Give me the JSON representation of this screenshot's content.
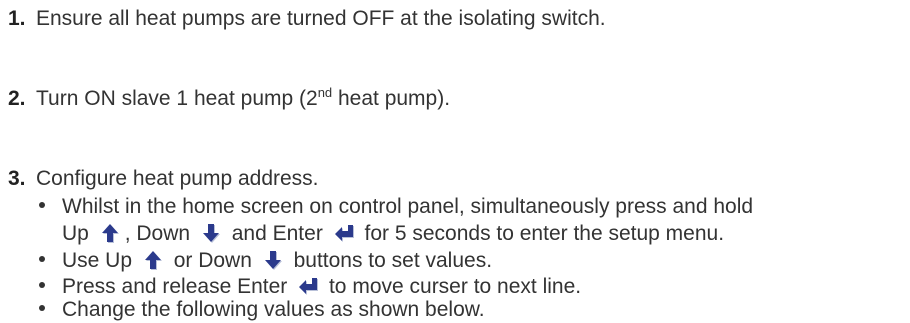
{
  "steps": [
    {
      "number": "1.",
      "text": "Ensure all heat pumps are turned OFF at the isolating switch."
    },
    {
      "number": "2.",
      "text_before": "Turn ON slave 1 heat pump (2",
      "sup": "nd",
      "text_after": " heat pump)."
    },
    {
      "number": "3.",
      "text": "Configure heat pump address."
    }
  ],
  "bullets": {
    "b1": {
      "line1": "Whilst in the home screen on control panel, simultaneously press and hold",
      "line2_a": "Up",
      "line2_b": ", Down",
      "line2_c": " and Enter",
      "line2_d": " for 5 seconds to enter the setup menu."
    },
    "b2": {
      "a": "Use Up",
      "b": " or Down",
      "c": " buttons to set values."
    },
    "b3": {
      "a": "Press and release Enter",
      "b": " to move curser to next line."
    },
    "b4": {
      "text": "Change the following values as shown below."
    }
  },
  "icons": {
    "up": "up-arrow-icon",
    "down": "down-arrow-icon",
    "enter": "enter-arrow-icon",
    "icon_color": "#2b3a8c",
    "icon_shadow": "#b8c0d8"
  }
}
